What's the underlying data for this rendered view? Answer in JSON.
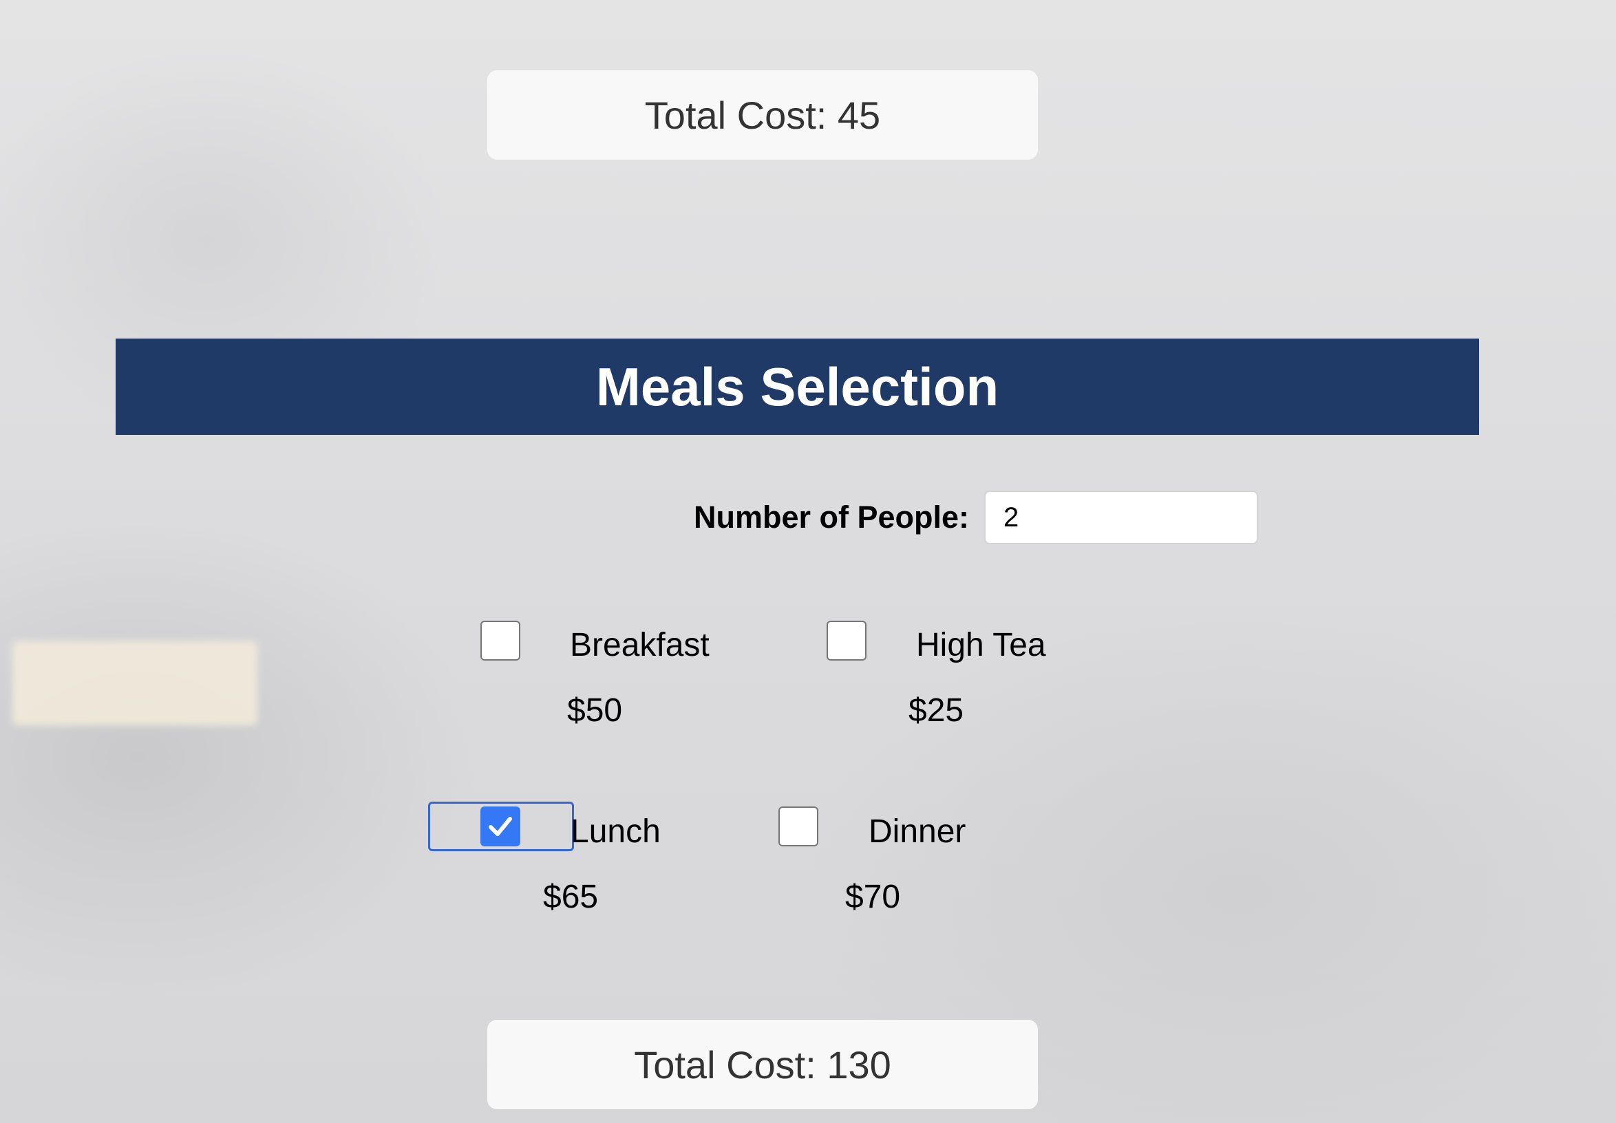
{
  "totals": {
    "top_label": "Total Cost: 45",
    "bottom_label": "Total Cost: 130"
  },
  "section": {
    "title": "Meals Selection"
  },
  "people": {
    "label": "Number of People:",
    "value": "2"
  },
  "meals": [
    {
      "name": "Breakfast",
      "price": "$50",
      "checked": false
    },
    {
      "name": "High Tea",
      "price": "$25",
      "checked": false
    },
    {
      "name": "Lunch",
      "price": "$65",
      "checked": true
    },
    {
      "name": "Dinner",
      "price": "$70",
      "checked": false
    }
  ],
  "icons": {
    "checkmark": "checkmark-icon"
  },
  "colors": {
    "banner": "#1f3a66",
    "checkbox_checked": "#3478f6",
    "focus_ring": "#3467d8"
  }
}
